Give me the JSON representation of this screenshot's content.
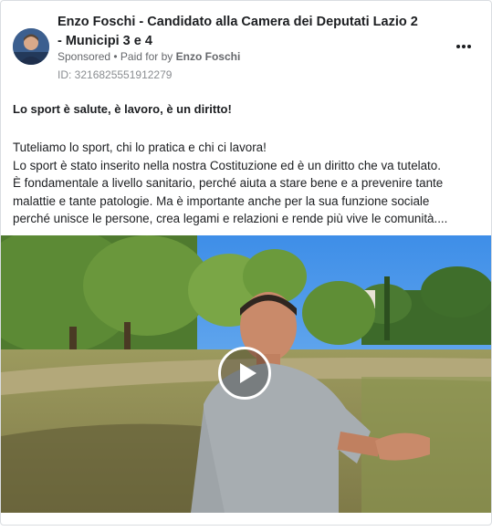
{
  "post": {
    "page_name": "Enzo Foschi - Candidato alla Camera dei Deputati Lazio 2 - Municipi 3 e 4",
    "sponsored": "Sponsored",
    "paid_for_prefix": " • Paid for by ",
    "paid_for_name": "Enzo Foschi",
    "ad_id": "ID: 3216825551912279",
    "headline": "Lo sport è salute, è lavoro, è un diritto!",
    "body_lines": [
      "Tuteliamo lo sport, chi lo pratica e chi ci lavora!",
      "Lo sport è stato inserito nella nostra Costituzione ed è un diritto che va tutelato.",
      "È fondamentale a livello sanitario, perché aiuta a stare bene e a prevenire tante",
      "malattie e tante patologie. Ma è importante anche per la sua funzione sociale",
      "perché unisce le persone, crea legami e relazioni e rende più vive le comunità...."
    ]
  },
  "icons": {
    "more": "more-options-icon",
    "play": "play-icon"
  },
  "colors": {
    "text_primary": "#1c1e21",
    "text_secondary": "#65676b",
    "border": "#dadde1"
  }
}
